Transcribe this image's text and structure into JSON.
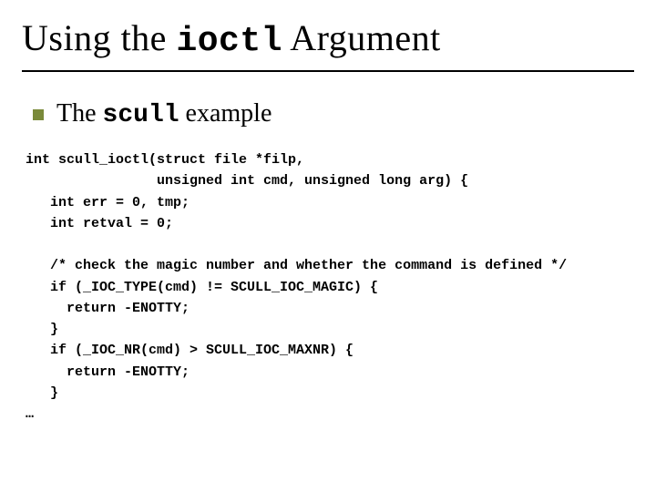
{
  "title": {
    "pre": "Using the ",
    "mono": "ioctl",
    "post": " Argument"
  },
  "subtitle": {
    "pre": "The ",
    "mono": "scull",
    "post": " example"
  },
  "code": "int scull_ioctl(struct file *filp,\n                unsigned int cmd, unsigned long arg) {\n   int err = 0, tmp;\n   int retval = 0;\n\n   /* check the magic number and whether the command is defined */\n   if (_IOC_TYPE(cmd) != SCULL_IOC_MAGIC) {\n     return -ENOTTY;\n   }\n   if (_IOC_NR(cmd) > SCULL_IOC_MAXNR) {\n     return -ENOTTY;\n   }\n…"
}
